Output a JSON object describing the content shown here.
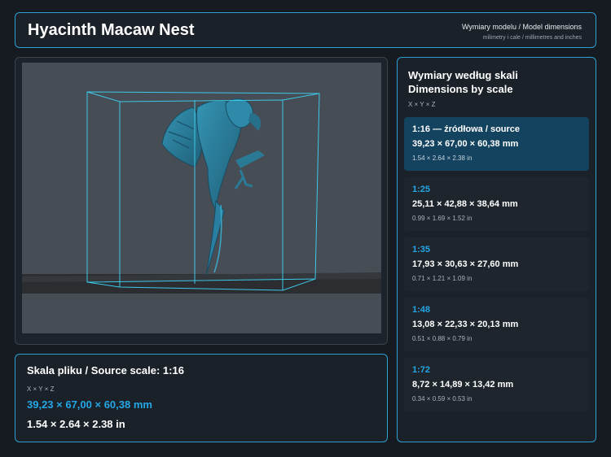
{
  "header": {
    "title": "Hyacinth Macaw Nest",
    "subtitle": "Wymiary modelu / Model dimensions",
    "units_note": "milimetry i cale / millimetres and inches"
  },
  "viewer": {
    "icon": "macaw-3d-model-icon",
    "colors": {
      "model": "#2c7f9c",
      "bbox": "#3cc8e6",
      "floor": "#2b2d31",
      "background": "#474d55"
    }
  },
  "source": {
    "heading": "Skala pliku / Source scale: 1:16",
    "axes": "X × Y × Z",
    "mm": "39,23 × 67,00 × 60,38 mm",
    "inches": "1.54 × 2.64 × 2.38 in"
  },
  "scales": {
    "heading_pl": "Wymiary według skali",
    "heading_en": "Dimensions by scale",
    "axes": "X × Y × Z",
    "items": [
      {
        "label": "1:16  —  źródłowa / source",
        "mm": "39,23 × 67,00 × 60,38 mm",
        "inches": "1.54 × 2.64 × 2.38 in",
        "active": true
      },
      {
        "label": "1:25",
        "mm": "25,11 × 42,88 × 38,64 mm",
        "inches": "0.99 × 1.69 × 1.52 in",
        "active": false
      },
      {
        "label": "1:35",
        "mm": "17,93 × 30,63 × 27,60 mm",
        "inches": "0.71 × 1.21 × 1.09 in",
        "active": false
      },
      {
        "label": "1:48",
        "mm": "13,08 × 22,33 × 20,13 mm",
        "inches": "0.51 × 0.88 × 0.79 in",
        "active": false
      },
      {
        "label": "1:72",
        "mm": "8,72 × 14,89 × 13,42 mm",
        "inches": "0.34 × 0.59 × 0.53 in",
        "active": false
      }
    ]
  },
  "colors": {
    "accent": "#25a7e6",
    "border": "#2e9fd0",
    "background": "#161b21",
    "active_item": "#144360"
  }
}
